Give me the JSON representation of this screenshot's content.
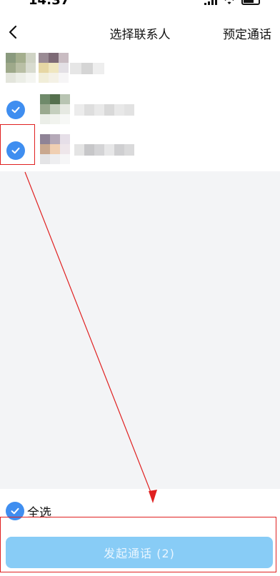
{
  "status_bar": {
    "time": "14:37"
  },
  "header": {
    "title": "选择联系人",
    "schedule_label": "预定通话"
  },
  "contacts": [
    {
      "checked": false
    },
    {
      "checked": true
    },
    {
      "checked": true
    }
  ],
  "footer": {
    "select_all_label": "全选",
    "start_call_label": "发起通话 (2)"
  },
  "colors": {
    "accent": "#3f8ef0",
    "button": "#88ccf6",
    "annotation": "#e02020",
    "background": "#f3f4f6"
  }
}
